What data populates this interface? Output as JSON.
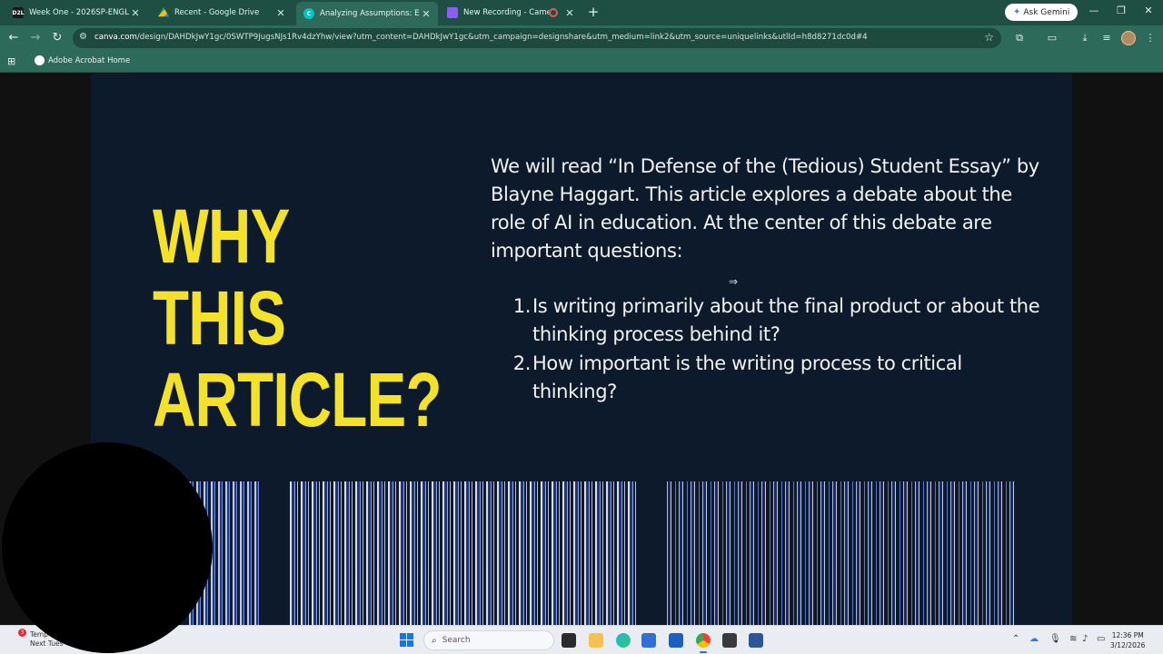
{
  "browser": {
    "tabs": [
      {
        "title": "Week One - 2026SP-ENGL-130...",
        "fav_text": "D2L",
        "fav_color": "#1a1a1a",
        "active": false
      },
      {
        "title": "Recent - Google Drive",
        "fav_text": "",
        "fav_color": "#34a853",
        "active": false
      },
      {
        "title": "Analyzing Assumptions: Essay W...",
        "fav_text": "C",
        "fav_color": "#00c4cc",
        "active": true
      },
      {
        "title": "New Recording - Camera",
        "fav_text": "",
        "fav_color": "#8b5cf6",
        "active": false
      }
    ],
    "ask_gemini": "Ask Gemini",
    "url_domain": "canva.com",
    "url_path": "/design/DAHDkJwY1gc/0SWTP9JugsNJs1Rv4dzYhw/view?utm_content=DAHDkJwY1gc&utm_campaign=designshare&utm_medium=link2&utm_source=uniquelinks&utlId=h8d8271dc0d#4",
    "bookmark": "Adobe Acrobat Home"
  },
  "slide": {
    "headline_line1": "WHY THIS",
    "headline_line2": "ARTICLE?",
    "body": "We will read “In Defense of the (Tedious) Student Essay” by Blayne Haggart.  This article explores a debate about the role of AI in education. At the center of this debate are important questions:",
    "questions": [
      {
        "num": "1.",
        "text": "Is writing primarily about the final product or about the thinking process behind it?"
      },
      {
        "num": "2.",
        "text": "How important is the writing process to critical thinking?"
      }
    ],
    "headline_color": "#f3e12a",
    "background_color": "#0d1a2c"
  },
  "taskbar": {
    "weather_line1": "Temp",
    "weather_line2": "Next Tues",
    "weather_badge": "3",
    "search_placeholder": "Search",
    "time": "12:36 PM",
    "date": "3/12/2026"
  }
}
